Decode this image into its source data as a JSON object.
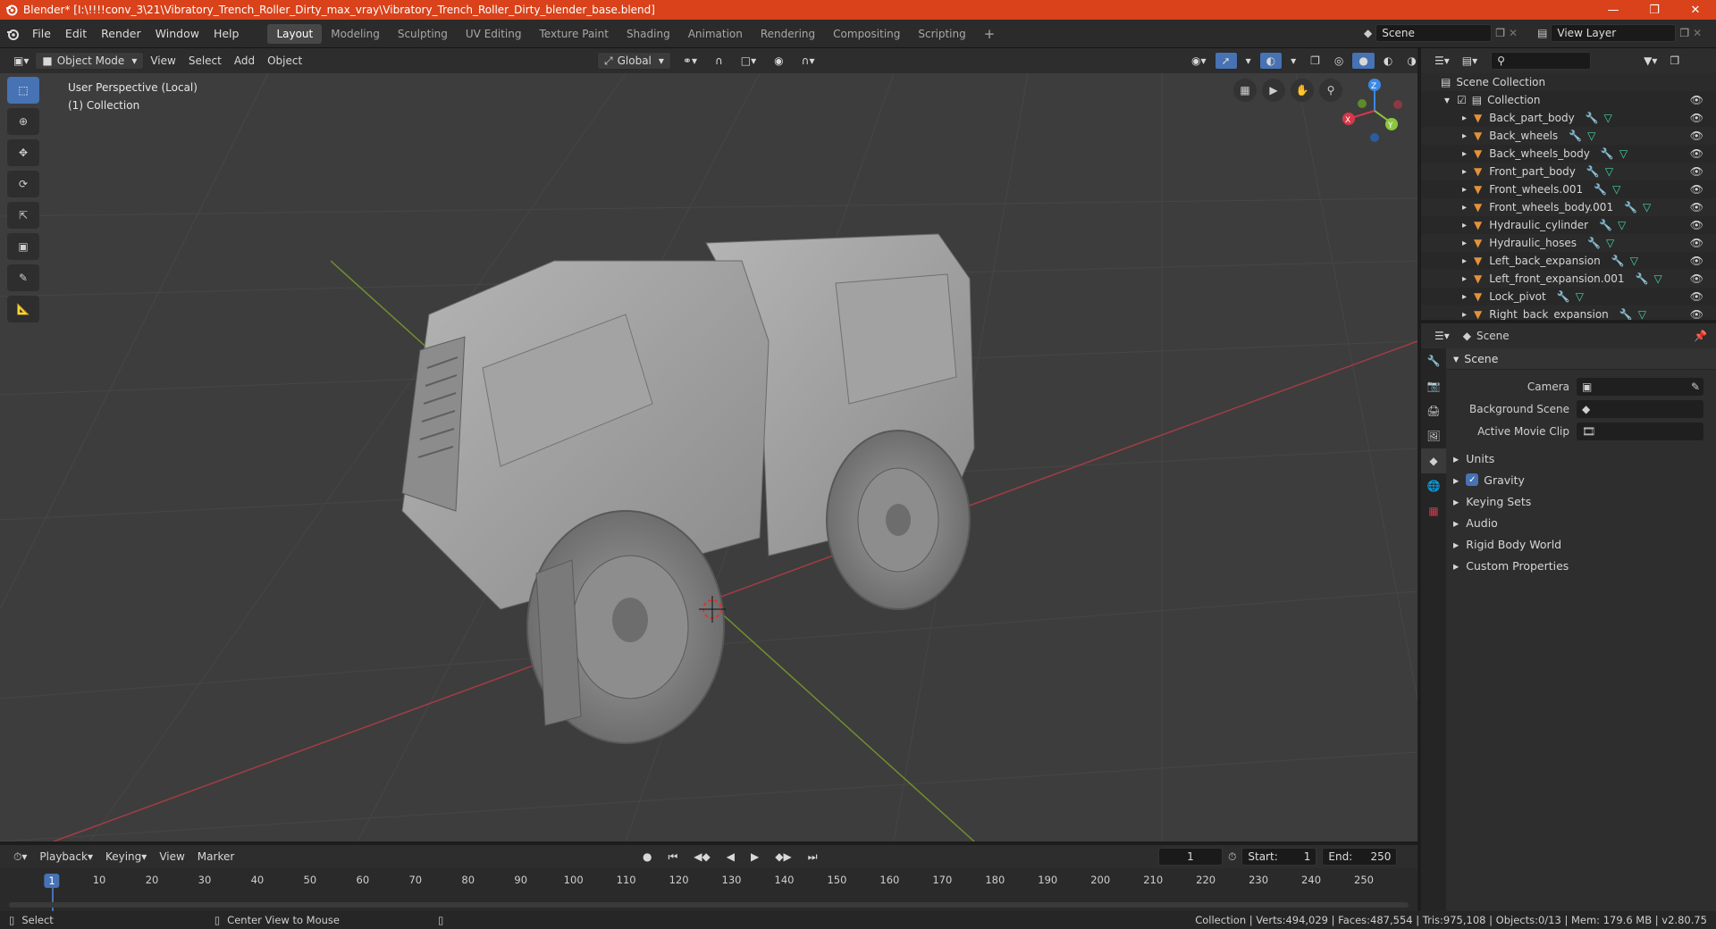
{
  "window": {
    "title": "Blender* [I:\\!!!!conv_3\\21\\Vibratory_Trench_Roller_Dirty_max_vray\\Vibratory_Trench_Roller_Dirty_blender_base.blend]"
  },
  "menu": [
    "File",
    "Edit",
    "Render",
    "Window",
    "Help"
  ],
  "workspaces": [
    "Layout",
    "Modeling",
    "Sculpting",
    "UV Editing",
    "Texture Paint",
    "Shading",
    "Animation",
    "Rendering",
    "Compositing",
    "Scripting"
  ],
  "active_workspace": "Layout",
  "scene_field": "Scene",
  "view_layer_field": "View Layer",
  "viewport_header": {
    "mode": "Object Mode",
    "items": [
      "View",
      "Select",
      "Add",
      "Object"
    ],
    "orientation": "Global"
  },
  "viewport": {
    "perspective": "User Perspective (Local)",
    "collection": "(1) Collection",
    "gizmo_axes": [
      "X",
      "Y",
      "Z"
    ]
  },
  "outliner": {
    "root": "Scene Collection",
    "collection": "Collection",
    "objects": [
      "Back_part_body",
      "Back_wheels",
      "Back_wheels_body",
      "Front_part_body",
      "Front_wheels.001",
      "Front_wheels_body.001",
      "Hydraulic_cylinder",
      "Hydraulic_hoses",
      "Left_back_expansion",
      "Left_front_expansion.001",
      "Lock_pivot",
      "Right_back_expansion"
    ]
  },
  "properties": {
    "header": "Scene",
    "panel": "Scene",
    "camera_label": "Camera",
    "background_label": "Background Scene",
    "clip_label": "Active Movie Clip",
    "subpanels": [
      "Units",
      "Gravity",
      "Keying Sets",
      "Audio",
      "Rigid Body World",
      "Custom Properties"
    ]
  },
  "timeline": {
    "menus": [
      "Playback",
      "Keying",
      "View",
      "Marker"
    ],
    "current_frame": "1",
    "start_label": "Start:",
    "start": "1",
    "end_label": "End:",
    "end": "250",
    "ticks": [
      "1",
      "10",
      "20",
      "30",
      "40",
      "50",
      "60",
      "70",
      "80",
      "90",
      "100",
      "110",
      "120",
      "130",
      "140",
      "150",
      "160",
      "170",
      "180",
      "190",
      "200",
      "210",
      "220",
      "230",
      "240",
      "250"
    ]
  },
  "status": {
    "select": "Select",
    "center": "Center View to Mouse",
    "stats": "Collection | Verts:494,029 | Faces:487,554 | Tris:975,108 | Objects:0/13 | Mem: 179.6 MB | v2.80.75"
  },
  "colors": {
    "title_bar": "#d9421a",
    "active": "#4772b3",
    "x_axis": "#d6384a",
    "y_axis": "#8bc63d",
    "z_axis": "#3b88e5"
  }
}
